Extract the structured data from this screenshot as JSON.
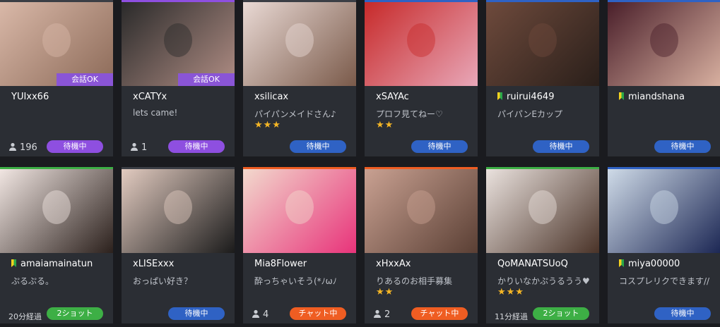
{
  "colors": {
    "purple": "#8e4fe0",
    "blue": "#2f62c4",
    "orange": "#ef5d22",
    "green": "#3daf45",
    "star": "#f5b625"
  },
  "cards": [
    {
      "name": "YUIxx66",
      "comment": "",
      "stars": "",
      "viewers": "196",
      "elapsed": "",
      "status": "待機中",
      "status_color": "purple",
      "tag": "会話OK",
      "beginner": false,
      "top_color": "#3b3e45",
      "thumb": [
        "#d9b8a8",
        "#8c6a58"
      ]
    },
    {
      "name": "xCATYx",
      "comment": "lets came!",
      "stars": "",
      "viewers": "1",
      "elapsed": "",
      "status": "待機中",
      "status_color": "purple",
      "tag": "会話OK",
      "beginner": false,
      "top_color": "#8e4fe0",
      "thumb": [
        "#2a2a2a",
        "#b08d84"
      ]
    },
    {
      "name": "xsilicax",
      "comment": "パイパンメイドさん♪",
      "stars": "★★★",
      "viewers": "",
      "elapsed": "",
      "status": "待機中",
      "status_color": "blue",
      "tag": "",
      "beginner": false,
      "top_color": "#3b3e45",
      "thumb": [
        "#e9d9d4",
        "#7a5a4a"
      ]
    },
    {
      "name": "xSAYAc",
      "comment": "プロフ見てねー♡",
      "stars": "★★",
      "viewers": "",
      "elapsed": "",
      "status": "待機中",
      "status_color": "blue",
      "tag": "",
      "beginner": false,
      "top_color": "#2f62c4",
      "thumb": [
        "#c72a2a",
        "#e8a7b8"
      ]
    },
    {
      "name": "ruirui4649",
      "comment": "パイパンEカップ",
      "stars": "",
      "viewers": "",
      "elapsed": "",
      "status": "待機中",
      "status_color": "blue",
      "tag": "",
      "beginner": true,
      "top_color": "#2f62c4",
      "thumb": [
        "#6e4a3c",
        "#2a1f1a"
      ]
    },
    {
      "name": "miandshana",
      "comment": "",
      "stars": "",
      "viewers": "",
      "elapsed": "",
      "status": "待機中",
      "status_color": "blue",
      "tag": "",
      "beginner": true,
      "top_color": "#2f62c4",
      "thumb": [
        "#4a1f2a",
        "#d8b0a0"
      ]
    },
    {
      "name": "amaiamainatun",
      "comment": "ぷるぷる。",
      "stars": "",
      "viewers": "",
      "elapsed": "20分経過",
      "status": "2ショット",
      "status_color": "green",
      "tag": "",
      "beginner": true,
      "top_color": "#3daf45",
      "thumb": [
        "#f1e6e2",
        "#2b201c"
      ]
    },
    {
      "name": "xLISExxx",
      "comment": "おっぱい好き？",
      "stars": "",
      "viewers": "",
      "elapsed": "",
      "status": "待機中",
      "status_color": "blue",
      "tag": "",
      "beginner": false,
      "top_color": "#3b3e45",
      "thumb": [
        "#e2cbc0",
        "#1b1b1b"
      ]
    },
    {
      "name": "Mia8Flower",
      "comment": "酔っちゃいそう(*ﾉωﾉ",
      "stars": "",
      "viewers": "4",
      "elapsed": "",
      "status": "チャット中",
      "status_color": "orange",
      "tag": "",
      "beginner": false,
      "top_color": "#ef5d22",
      "thumb": [
        "#f2d9cd",
        "#e8337a"
      ]
    },
    {
      "name": "xHxxAx",
      "comment": "りあるのお相手募集",
      "stars": "★★",
      "viewers": "2",
      "elapsed": "",
      "status": "チャット中",
      "status_color": "orange",
      "tag": "",
      "beginner": false,
      "top_color": "#ef5d22",
      "thumb": [
        "#c9a192",
        "#5a3f34"
      ]
    },
    {
      "name": "QoMANATSUoQ",
      "comment": "かりいなかぷうるうう♥",
      "stars": "★★★",
      "viewers": "",
      "elapsed": "11分経過",
      "status": "2ショット",
      "status_color": "green",
      "tag": "",
      "beginner": false,
      "top_color": "#3daf45",
      "thumb": [
        "#eae2de",
        "#4a3328"
      ]
    },
    {
      "name": "miya00000",
      "comment": "コスプレリクできます//",
      "stars": "",
      "viewers": "",
      "elapsed": "",
      "status": "待機中",
      "status_color": "blue",
      "tag": "",
      "beginner": true,
      "top_color": "#2f62c4",
      "thumb": [
        "#cfdbe8",
        "#1c2754"
      ]
    }
  ]
}
